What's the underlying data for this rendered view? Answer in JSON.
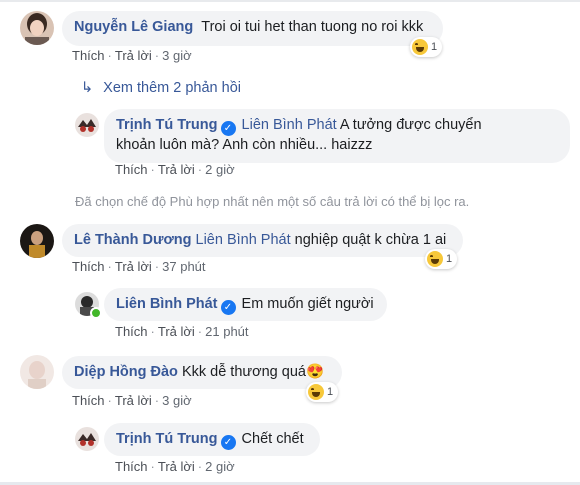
{
  "comments": [
    {
      "author": "Nguyễn Lê Giang",
      "text": "Troi oi tui het than tuong no roi kkk",
      "like": "Thích",
      "reply": "Trả lời",
      "time": "3 giờ",
      "reaction_count": "1",
      "reaction_icon": "haha-icon"
    },
    {
      "author": "Lê Thành Dương",
      "tag": "Liên Bình Phát",
      "text": "nghiệp quật k chừa 1 ai",
      "like": "Thích",
      "reply": "Trả lời",
      "time": "37 phút",
      "reaction_count": "1",
      "reaction_icon": "haha-icon"
    },
    {
      "author": "Diệp Hồng Đào",
      "text": "Kkk dễ thương quá",
      "emoji": "😍",
      "like": "Thích",
      "reply": "Trả lời",
      "time": "3 giờ",
      "reaction_count": "1",
      "reaction_icon": "haha-icon"
    }
  ],
  "replies": [
    {
      "author": "Trịnh Tú Trung",
      "tag": "Liên Bình Phát",
      "text_line1": "A tưởng được chuyển",
      "text_line2": "khoản luôn mà? Anh còn nhiều... haizzz",
      "like": "Thích",
      "reply": "Trả lời",
      "time": "2 giờ"
    },
    {
      "author": "Liên Bình Phát",
      "text": "Em muốn giết người",
      "like": "Thích",
      "reply": "Trả lời",
      "time": "21 phút"
    },
    {
      "author": "Trịnh Tú Trung",
      "text": "Chết chết",
      "like": "Thích",
      "reply": "Trả lời",
      "time": "2 giờ"
    }
  ],
  "more_replies": "Xem thêm 2 phản hồi",
  "filter_note": "Đã chọn chế độ Phù hợp nhất nên một số câu trả lời có thể bị lọc ra.",
  "verified_icon": "verified-badge-icon",
  "colors": {
    "link": "#385898",
    "bubble": "#f2f3f5",
    "verified": "#1877f2",
    "online": "#42b72a"
  }
}
